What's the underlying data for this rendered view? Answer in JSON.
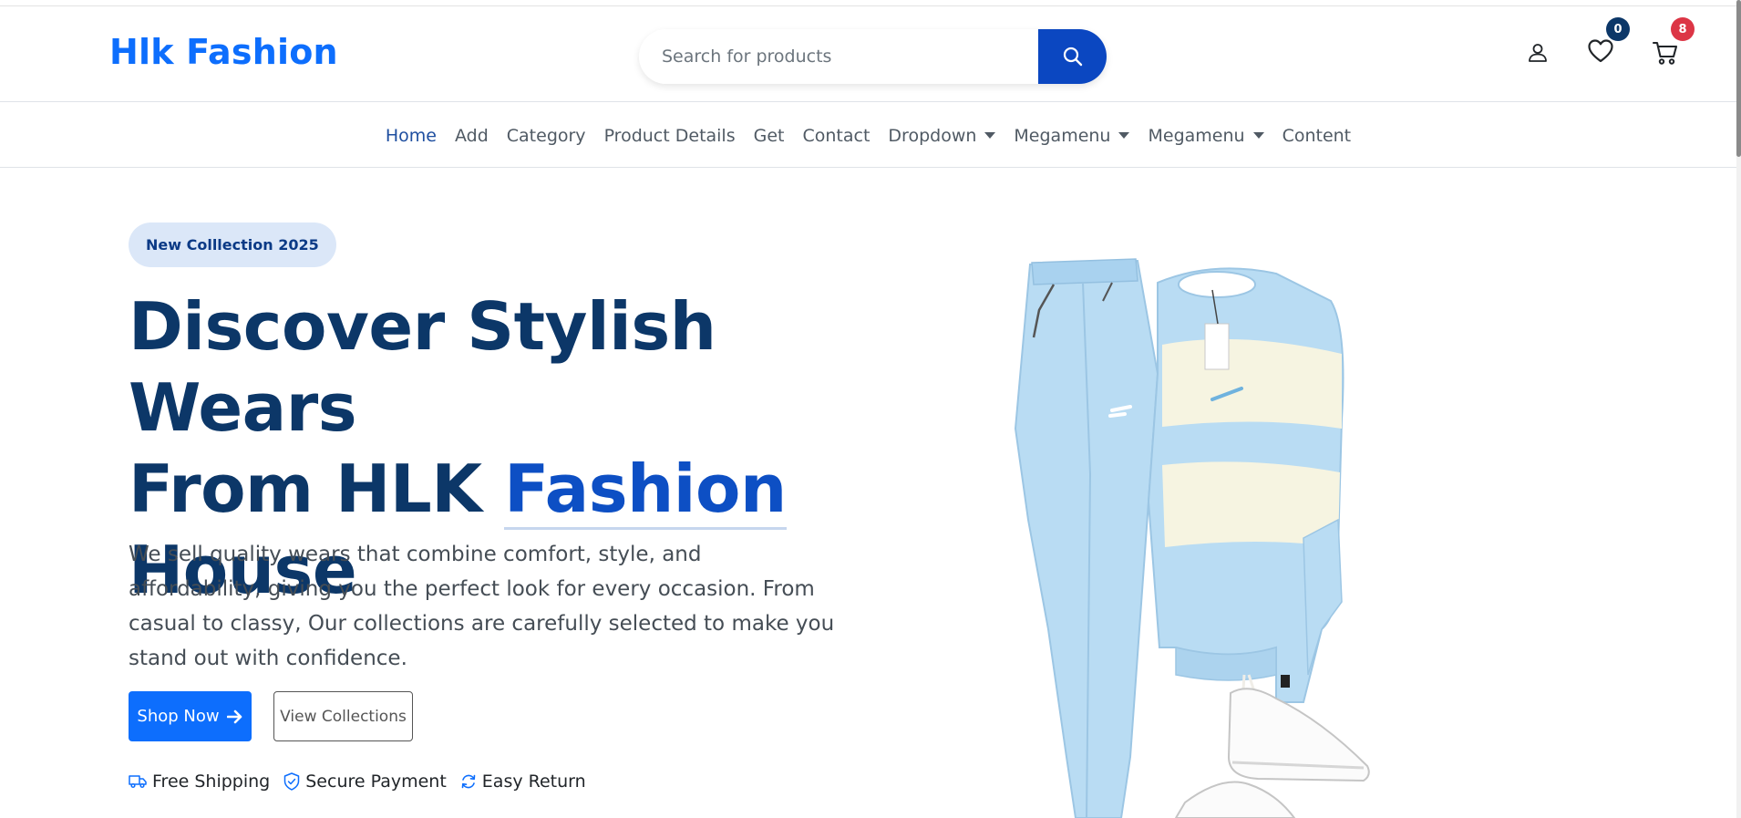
{
  "header": {
    "brand": "Hlk Fashion",
    "search_placeholder": "Search for products",
    "search_icon": "search-icon",
    "account_icon": "user-icon",
    "wishlist_icon": "heart-icon",
    "wishlist_count": "0",
    "cart_icon": "cart-icon",
    "cart_count": "8"
  },
  "nav": {
    "items": [
      {
        "label": "Home",
        "active": true
      },
      {
        "label": "Add"
      },
      {
        "label": "Category"
      },
      {
        "label": "Product Details"
      },
      {
        "label": "Get"
      },
      {
        "label": "Contact"
      },
      {
        "label": "Dropdown",
        "dropdown": true
      },
      {
        "label": "Megamenu",
        "dropdown": true
      },
      {
        "label": "Megamenu",
        "dropdown": true
      },
      {
        "label": "Content"
      }
    ]
  },
  "hero": {
    "badge": "New Colllection 2025",
    "title_line1": "Discover Stylish Wears",
    "title_line2_pre": "From HLK ",
    "title_line2_accent": "Fashion",
    "title_line3": "House",
    "description": "We sell quality wears that combine comfort, style, and affordability, giving you the perfect look for every occasion. From casual to classy, Our collections are carefully selected to make you stand out with confidence.",
    "shop_now": "Shop Now",
    "view_collections": "View Collections",
    "features": [
      {
        "icon": "truck-icon",
        "label": "Free Shipping"
      },
      {
        "icon": "shield-check-icon",
        "label": "Secure Payment"
      },
      {
        "icon": "refresh-icon",
        "label": "Easy Return"
      }
    ]
  },
  "colors": {
    "brand_blue": "#0d6efd",
    "navy": "#0c3768",
    "search_button": "#0b47c1",
    "wishlist_badge": "#0c3768",
    "cart_badge": "#dc3545",
    "product_light_blue": "#b9dcf3",
    "product_cream": "#f6f4e1"
  }
}
